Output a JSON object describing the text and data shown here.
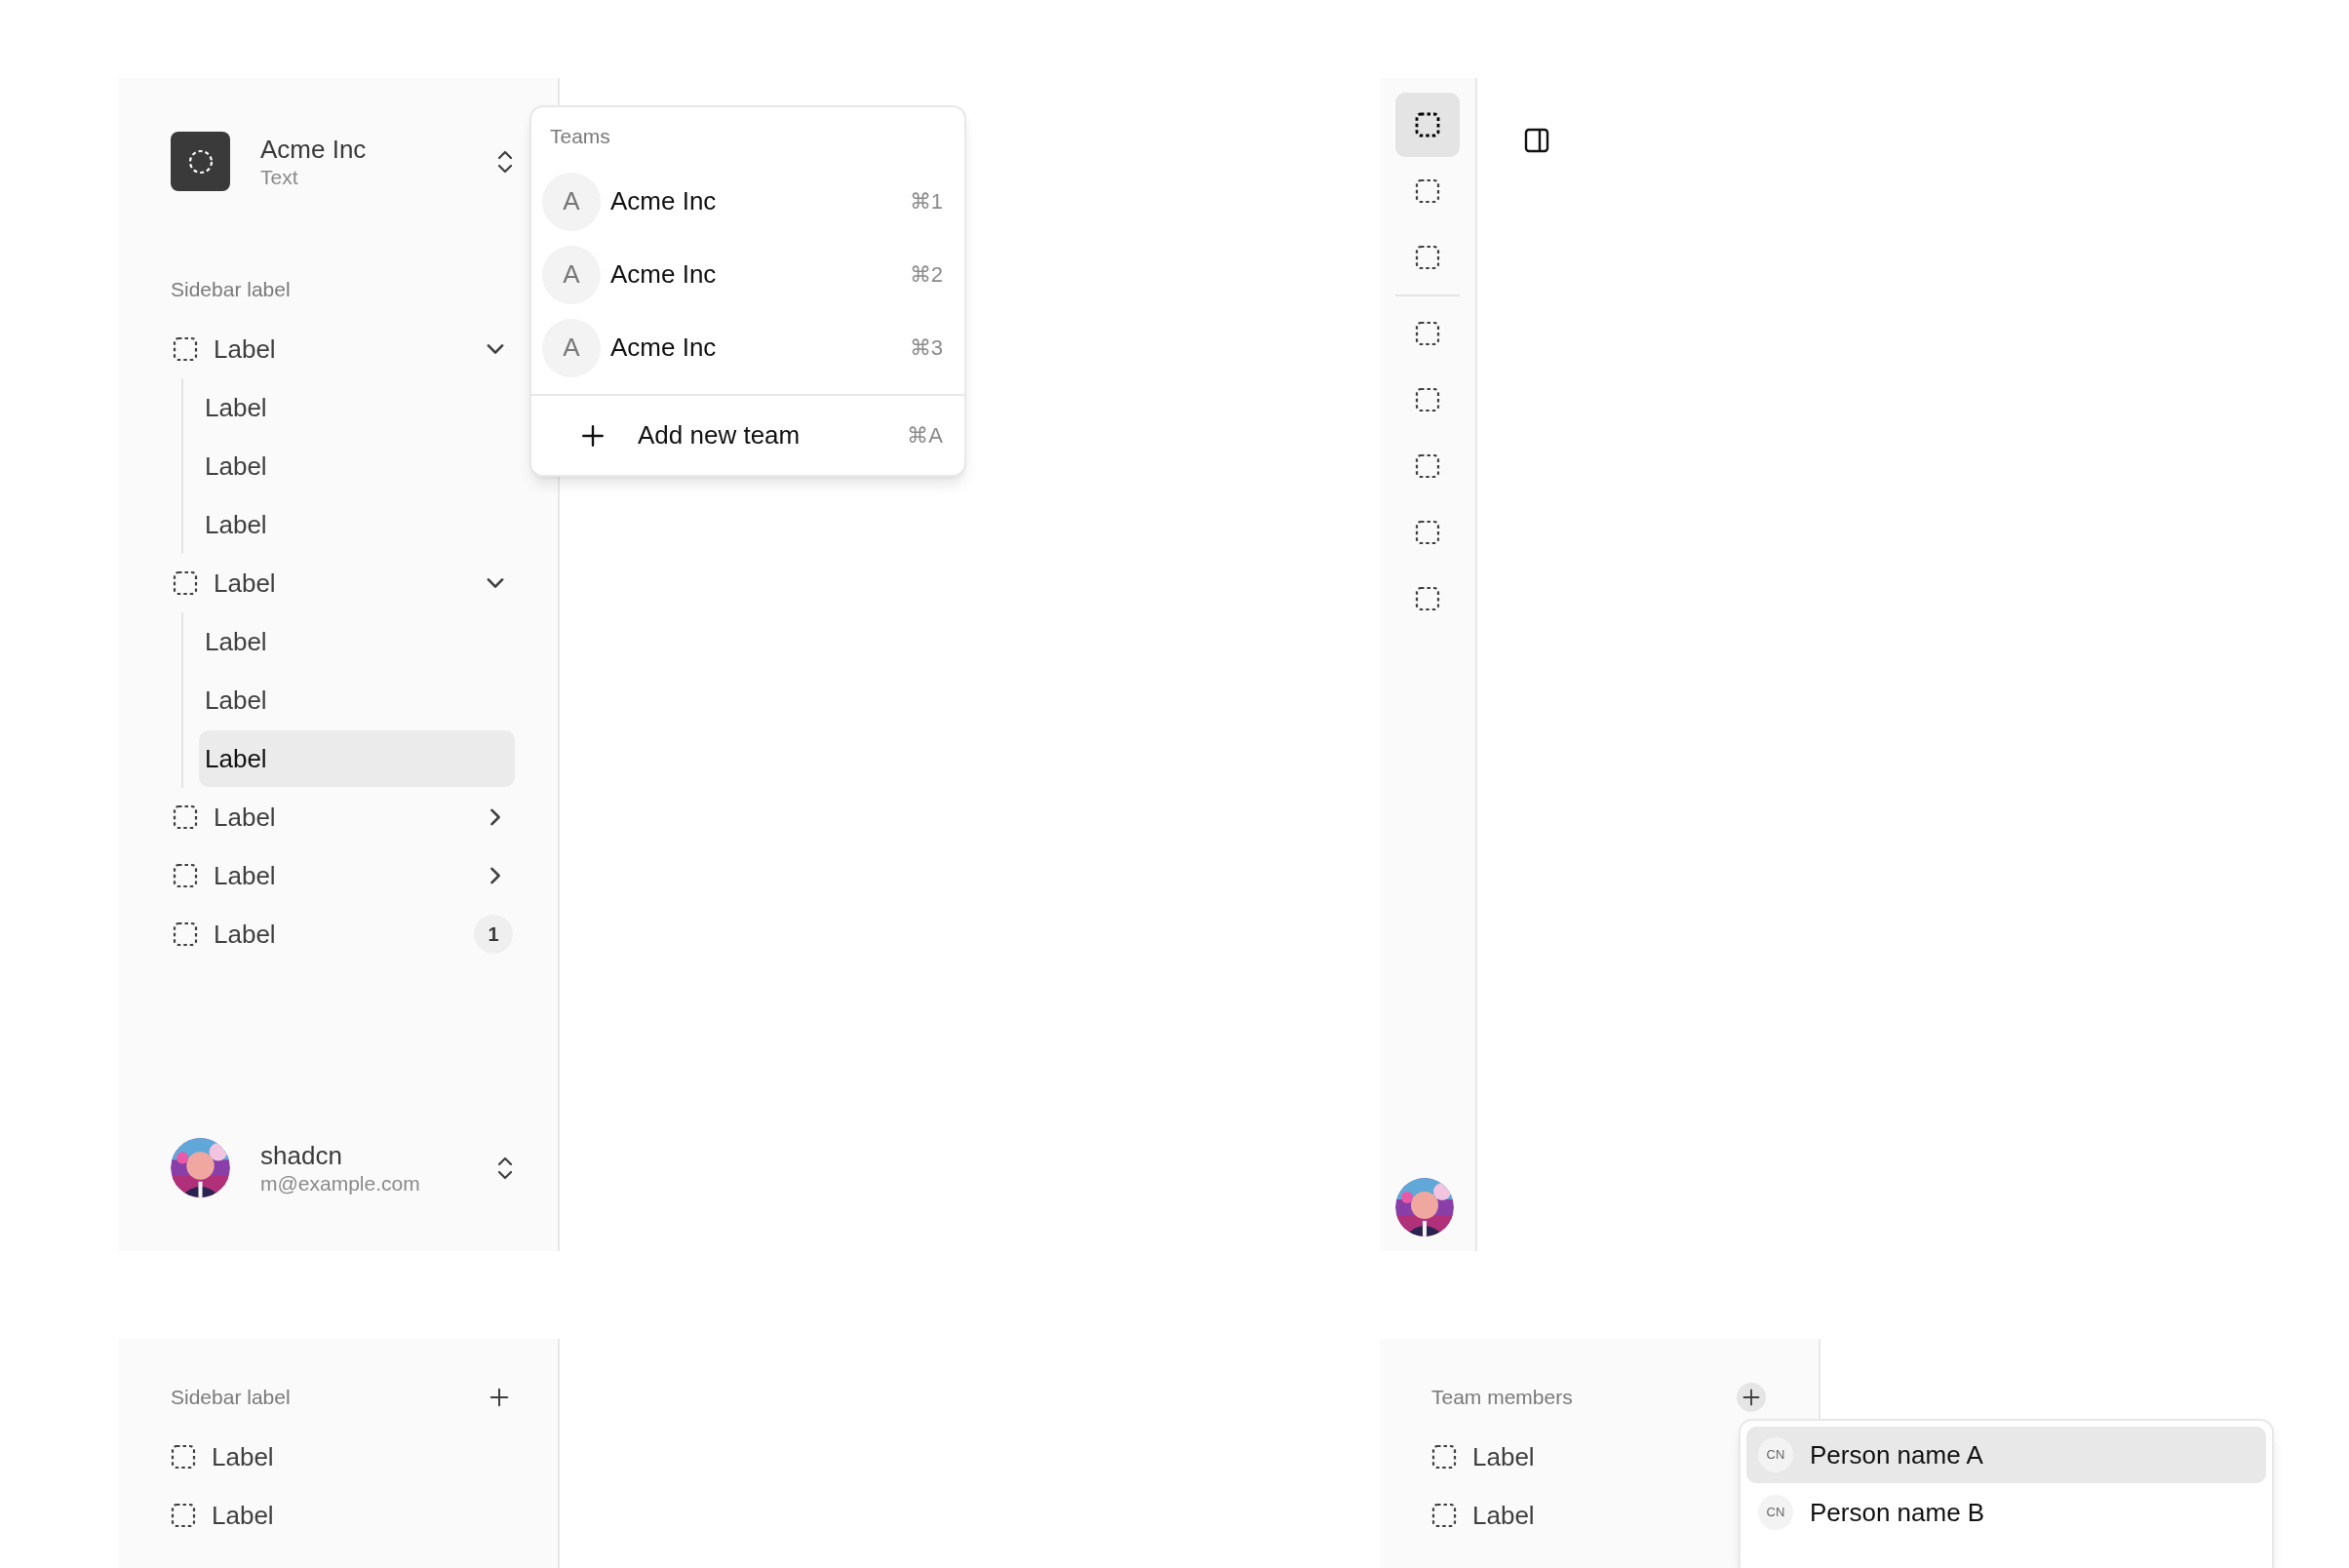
{
  "team_switcher": {
    "name": "Acme Inc",
    "plan": "Text"
  },
  "teams_menu": {
    "heading": "Teams",
    "teams": [
      {
        "initial": "A",
        "name": "Acme Inc",
        "shortcut": "⌘1"
      },
      {
        "initial": "A",
        "name": "Acme Inc",
        "shortcut": "⌘2"
      },
      {
        "initial": "A",
        "name": "Acme Inc",
        "shortcut": "⌘3"
      }
    ],
    "add_item": {
      "label": "Add new team",
      "shortcut": "⌘A"
    }
  },
  "nav": {
    "label": "Sidebar label",
    "items": [
      {
        "kind": "collapsible",
        "label": "Label",
        "expanded": true,
        "selected": false,
        "children": [
          {
            "label": "Label",
            "selected": false
          },
          {
            "label": "Label",
            "selected": false
          },
          {
            "label": "Label",
            "selected": false
          }
        ]
      },
      {
        "kind": "collapsible",
        "label": "Label",
        "expanded": true,
        "selected": false,
        "children": [
          {
            "label": "Label",
            "selected": false
          },
          {
            "label": "Label",
            "selected": false
          },
          {
            "label": "Label",
            "selected": true
          }
        ]
      },
      {
        "kind": "collapsible",
        "label": "Label",
        "expanded": false,
        "selected": false
      },
      {
        "kind": "collapsible",
        "label": "Label",
        "expanded": false,
        "selected": false
      },
      {
        "kind": "badge",
        "label": "Label",
        "badge": "1",
        "selected": false
      }
    ]
  },
  "user": {
    "name": "shadcn",
    "email": "m@example.com"
  },
  "icon_rail": {
    "groups": [
      {
        "items": [
          {
            "selected": true
          },
          {
            "selected": false
          },
          {
            "selected": false
          }
        ]
      },
      {
        "items": [
          {
            "selected": false
          },
          {
            "selected": false
          },
          {
            "selected": false
          },
          {
            "selected": false
          },
          {
            "selected": false
          }
        ]
      }
    ]
  },
  "group_section": {
    "label": "Sidebar label",
    "items": [
      {
        "label": "Label"
      },
      {
        "label": "Label"
      }
    ]
  },
  "team_members": {
    "label": "Team members",
    "items": [
      {
        "label": "Label"
      },
      {
        "label": "Label"
      }
    ],
    "menu": [
      {
        "initials": "CN",
        "name": "Person name A",
        "selected": true
      },
      {
        "initials": "CN",
        "name": "Person name B",
        "selected": false
      }
    ]
  }
}
